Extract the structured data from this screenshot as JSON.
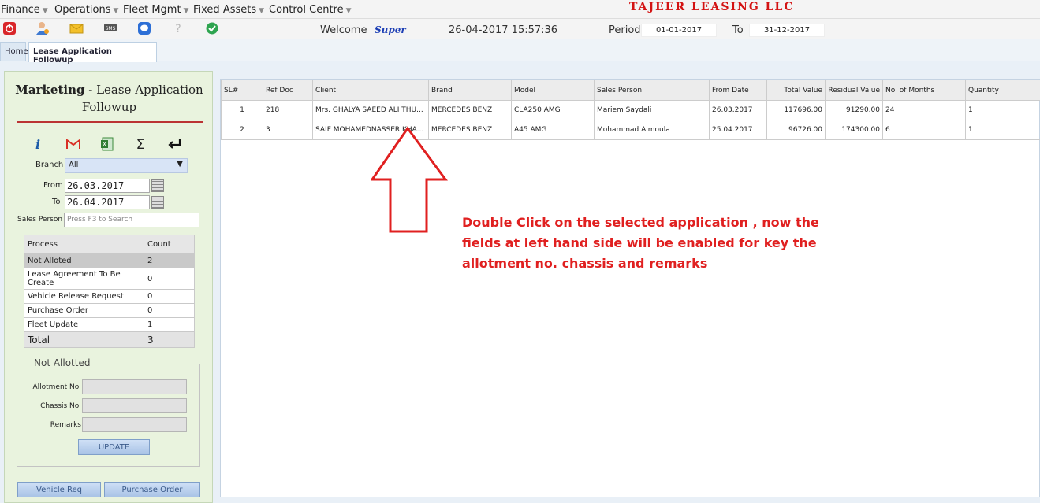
{
  "menu": [
    "Finance",
    "Operations",
    "Fleet Mgmt",
    "Fixed Assets",
    "Control Centre"
  ],
  "company": "TAJEER LEASING LLC",
  "toolbar": {
    "welcome": "Welcome",
    "user": "Super",
    "datetime": "26-04-2017 15:57:36",
    "period_label": "Period",
    "period_from": "01-01-2017",
    "to_label": "To",
    "period_to": "31-12-2017",
    "icons": [
      "power-icon",
      "user-icon",
      "mail-icon",
      "sms-icon",
      "chat-icon",
      "help-icon",
      "check-icon"
    ]
  },
  "tabs": [
    "Home",
    "Lease Application Followup"
  ],
  "left": {
    "title_bold": "Marketing",
    "title_rest": " - Lease Application Followup",
    "icons": [
      "info-icon",
      "gmail-icon",
      "excel-icon",
      "sigma-icon",
      "return-icon"
    ],
    "branch_label": "Branch",
    "branch_value": "All",
    "from_label": "From",
    "from_value": "26.03.2017",
    "to_label": "To",
    "to_value": "26.04.2017",
    "sales_label": "Sales Person",
    "sales_placeholder": "Press F3 to Search",
    "process_header": "Process",
    "count_header": "Count",
    "processes": [
      {
        "name": "Not Alloted",
        "count": "2"
      },
      {
        "name": "Lease Agreement To Be Create",
        "count": "0"
      },
      {
        "name": "Vehicle Release Request",
        "count": "0"
      },
      {
        "name": "Purchase Order",
        "count": "0"
      },
      {
        "name": "Fleet Update",
        "count": "1"
      }
    ],
    "total_label": "Total",
    "total_value": "3",
    "section_title": "Not Allotted",
    "allotment_label": "Allotment No.",
    "chassis_label": "Chassis No.",
    "remarks_label": "Remarks",
    "update_btn": "UPDATE",
    "vehicle_req_btn": "Vehicle Req",
    "purchase_order_btn": "Purchase Order"
  },
  "grid": {
    "headers": [
      "SL#",
      "Ref Doc",
      "Client",
      "Brand",
      "Model",
      "Sales Person",
      "From Date",
      "Total Value",
      "Residual Value",
      "No. of Months",
      "Quantity"
    ],
    "rows": [
      [
        "1",
        "218",
        "Mrs. GHALYA SAEED ALI THU...",
        "MERCEDES BENZ",
        "CLA250 AMG",
        "Mariem Saydali",
        "26.03.2017",
        "117696.00",
        "91290.00",
        "24",
        "1"
      ],
      [
        "2",
        "3",
        "SAIF MOHAMEDNASSER KHA...",
        "MERCEDES BENZ",
        "A45 AMG",
        "Mohammad Almoula",
        "25.04.2017",
        "96726.00",
        "174300.00",
        "6",
        "1"
      ]
    ]
  },
  "annotation": "Double Click on the selected application , now the fields at left hand side will be enabled for key the allotment no. chassis and remarks"
}
